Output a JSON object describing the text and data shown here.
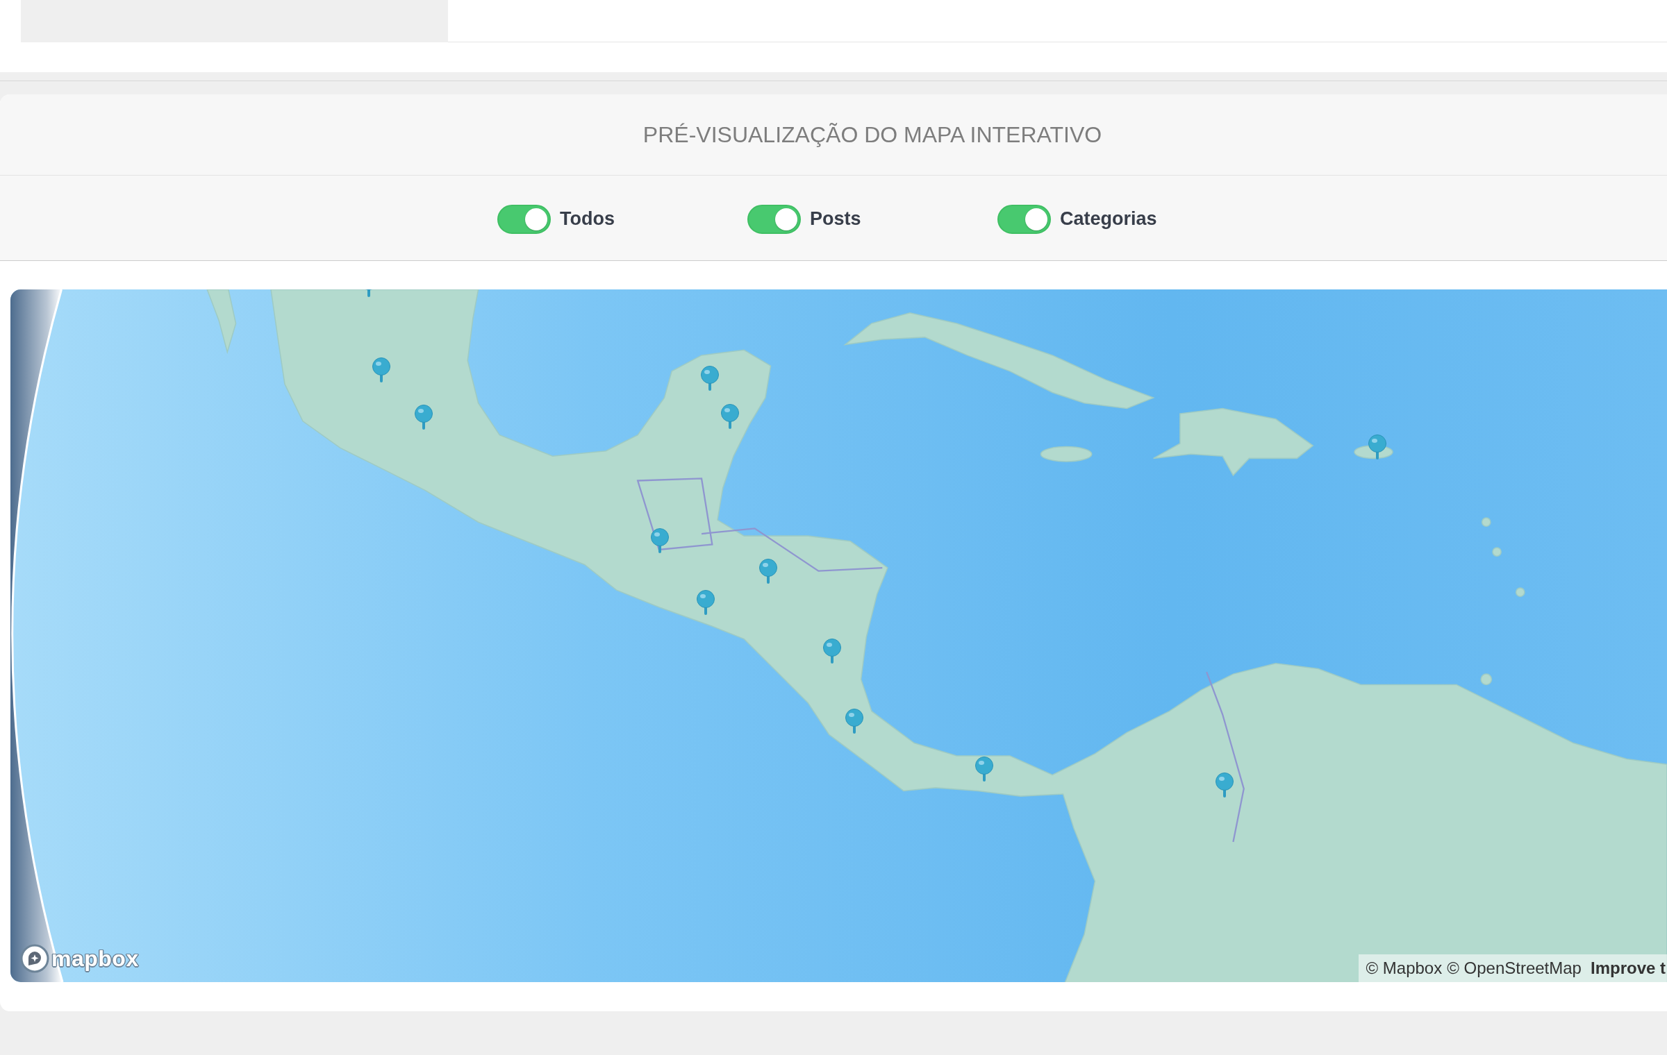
{
  "preview": {
    "title": "PRÉ-VISUALIZAÇÃO DO MAPA INTERATIVO",
    "toggles": [
      {
        "label": "Todos",
        "on": true
      },
      {
        "label": "Posts",
        "on": true
      },
      {
        "label": "Categorias",
        "on": true
      }
    ]
  },
  "map": {
    "logo": "mapbox",
    "attribution": [
      {
        "kind": "credit",
        "text": "© Mapbox"
      },
      {
        "kind": "credit",
        "text": "© OpenStreetMap"
      },
      {
        "kind": "feedback",
        "text": "Improve t"
      }
    ]
  }
}
